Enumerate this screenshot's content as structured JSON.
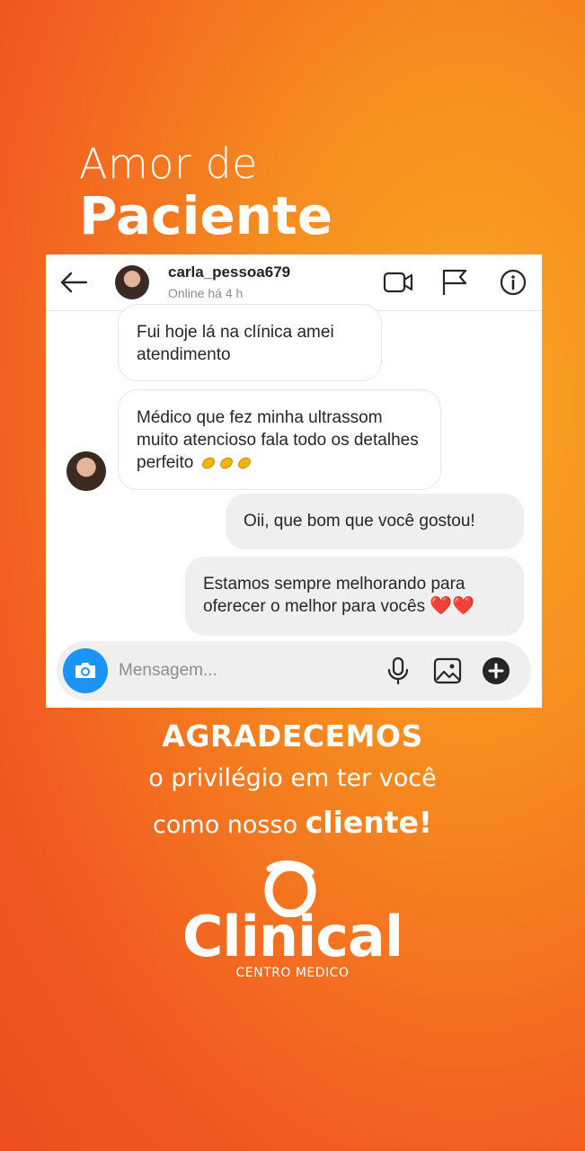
{
  "headline": {
    "line1": "Amor de",
    "line2": "Paciente"
  },
  "chat": {
    "username": "carla_pessoa679",
    "status": "Online há 4 h",
    "icons": [
      "back-arrow-icon",
      "video-camera-icon",
      "flag-icon",
      "info-icon"
    ],
    "messages": [
      {
        "from": "them",
        "text": "Fui hoje lá na clínica amei atendimento"
      },
      {
        "from": "them",
        "text": "Médico que fez minha ultrassom muito atencioso fala todo os detalhes perfeito",
        "emoji": "clapping-hands"
      },
      {
        "from": "me",
        "text": "Oii, que bom que você gostou!"
      },
      {
        "from": "me",
        "text": "Estamos sempre melhorando para oferecer o melhor para vocês",
        "emoji": "❤️❤️"
      }
    ],
    "input": {
      "placeholder": "Mensagem...",
      "icons": [
        "camera-icon",
        "microphone-icon",
        "gallery-icon",
        "plus-circle-icon"
      ]
    }
  },
  "thanks": {
    "line1": "AGRADECEMOS",
    "line2": "o privilégio em ter você",
    "line3_prefix": "como nosso",
    "line3_bold": "cliente!"
  },
  "brand": {
    "name": "Clinical",
    "subtitle": "CENTRO MEDICO"
  },
  "colors": {
    "background_orange": "#f15a22",
    "background_yellow": "#f9a825",
    "camera_blue": "#1b95f5"
  }
}
